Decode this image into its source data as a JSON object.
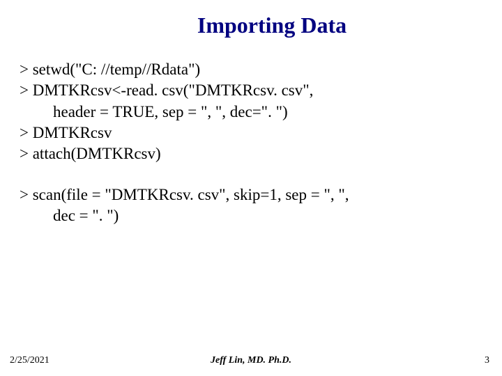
{
  "title": "Importing Data",
  "code": {
    "block1": {
      "l1": "> setwd(\"C: //temp//Rdata\")",
      "l2": "> DMTKRcsv<-read. csv(\"DMTKRcsv. csv\",",
      "l3": "header = TRUE, sep = \", \", dec=\". \")",
      "l4": "> DMTKRcsv",
      "l5": "> attach(DMTKRcsv)"
    },
    "block2": {
      "l1": "> scan(file = \"DMTKRcsv. csv\", skip=1, sep = \", \",",
      "l2": "dec = \". \")"
    }
  },
  "footer": {
    "date": "2/25/2021",
    "author": "Jeff Lin, MD. Ph.D.",
    "page": "3"
  }
}
